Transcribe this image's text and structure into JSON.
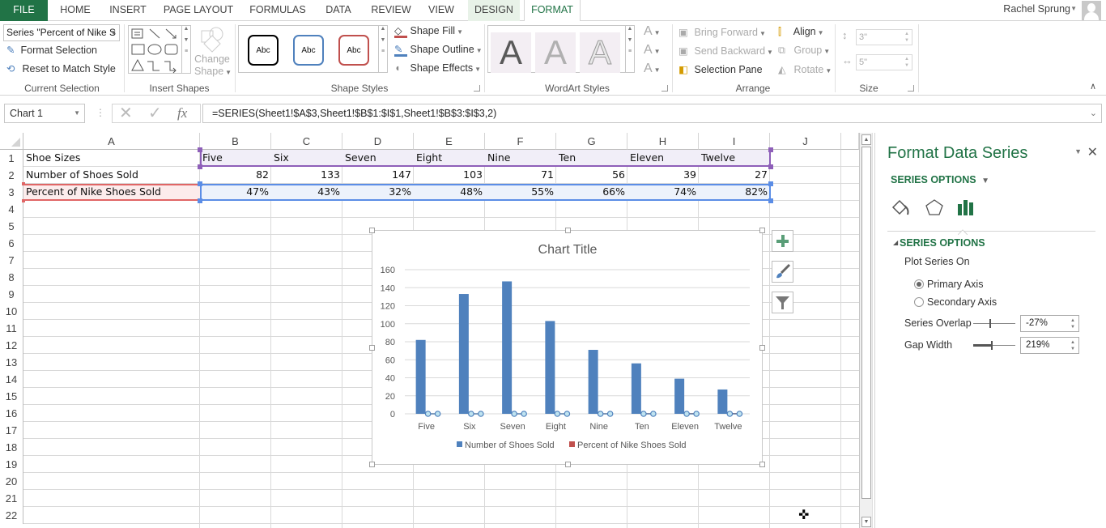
{
  "tabs": {
    "file": "FILE",
    "items": [
      "HOME",
      "INSERT",
      "PAGE LAYOUT",
      "FORMULAS",
      "DATA",
      "REVIEW",
      "VIEW",
      "DESIGN",
      "FORMAT"
    ],
    "active": "FORMAT",
    "user": "Rachel Sprung"
  },
  "ribbon": {
    "current_selection": {
      "selector_value": "Series \"Percent of Nike S",
      "format_selection": "Format Selection",
      "reset_to_match_style": "Reset to Match Style",
      "label": "Current Selection"
    },
    "insert_shapes": {
      "change_shape_1": "Change",
      "change_shape_2": "Shape",
      "label": "Insert Shapes"
    },
    "shape_styles": {
      "presets": [
        "Abc",
        "Abc",
        "Abc"
      ],
      "preset_colors": [
        "#000000",
        "#4f81bd",
        "#c0504d"
      ],
      "shape_fill": "Shape Fill",
      "shape_outline": "Shape Outline",
      "shape_effects": "Shape Effects",
      "label": "Shape Styles"
    },
    "wordart_styles": {
      "presets": [
        "A",
        "A",
        "A"
      ],
      "label": "WordArt Styles"
    },
    "arrange": {
      "bring_forward": "Bring Forward",
      "send_backward": "Send Backward",
      "selection_pane": "Selection Pane",
      "align": "Align",
      "group": "Group",
      "rotate": "Rotate",
      "label": "Arrange"
    },
    "size": {
      "height": "3\"",
      "width": "5\"",
      "label": "Size"
    }
  },
  "formula_bar": {
    "name_box": "Chart 1",
    "fx": "fx",
    "formula": "=SERIES(Sheet1!$A$3,Sheet1!$B$1:$I$1,Sheet1!$B$3:$I$3,2)"
  },
  "sheet": {
    "columns": [
      "A",
      "B",
      "C",
      "D",
      "E",
      "F",
      "G",
      "H",
      "I",
      "J"
    ],
    "rows": [
      "1",
      "2",
      "3",
      "4",
      "5",
      "6",
      "7",
      "8",
      "9",
      "10",
      "11",
      "12",
      "13",
      "14",
      "15",
      "16",
      "17",
      "18",
      "19",
      "20",
      "21",
      "22"
    ],
    "cells": {
      "row1": [
        "Shoe Sizes",
        "Five",
        "Six",
        "Seven",
        "Eight",
        "Nine",
        "Ten",
        "Eleven",
        "Twelve"
      ],
      "row2": [
        "Number of Shoes Sold",
        "82",
        "133",
        "147",
        "103",
        "71",
        "56",
        "39",
        "27"
      ],
      "row3": [
        "Percent of Nike Shoes Sold",
        "47%",
        "43%",
        "32%",
        "48%",
        "55%",
        "66%",
        "74%",
        "82%"
      ]
    }
  },
  "chart_data": {
    "type": "bar",
    "title": "Chart Title",
    "categories": [
      "Five",
      "Six",
      "Seven",
      "Eight",
      "Nine",
      "Ten",
      "Eleven",
      "Twelve"
    ],
    "series": [
      {
        "name": "Number of Shoes Sold",
        "values": [
          82,
          133,
          147,
          103,
          71,
          56,
          39,
          27
        ],
        "color": "#4f81bd"
      },
      {
        "name": "Percent of Nike Shoes Sold",
        "values": [
          0.47,
          0.43,
          0.32,
          0.48,
          0.55,
          0.66,
          0.74,
          0.82
        ],
        "color": "#c0504d",
        "selected": true
      }
    ],
    "yticks": [
      "0",
      "20",
      "40",
      "60",
      "80",
      "100",
      "120",
      "140",
      "160"
    ],
    "ylim": [
      0,
      160
    ],
    "xlabel": "",
    "ylabel": "",
    "grid": true,
    "legend": "bottom"
  },
  "format_pane": {
    "title": "Format Data Series",
    "options_dropdown": "SERIES OPTIONS",
    "section": "SERIES OPTIONS",
    "plot_series_on": "Plot Series On",
    "primary_axis": "Primary Axis",
    "secondary_axis": "Secondary Axis",
    "plot_on": "primary",
    "series_overlap_label": "Series Overlap",
    "series_overlap": "-27%",
    "gap_width_label": "Gap Width",
    "gap_width": "219%",
    "accent": "#217346"
  }
}
